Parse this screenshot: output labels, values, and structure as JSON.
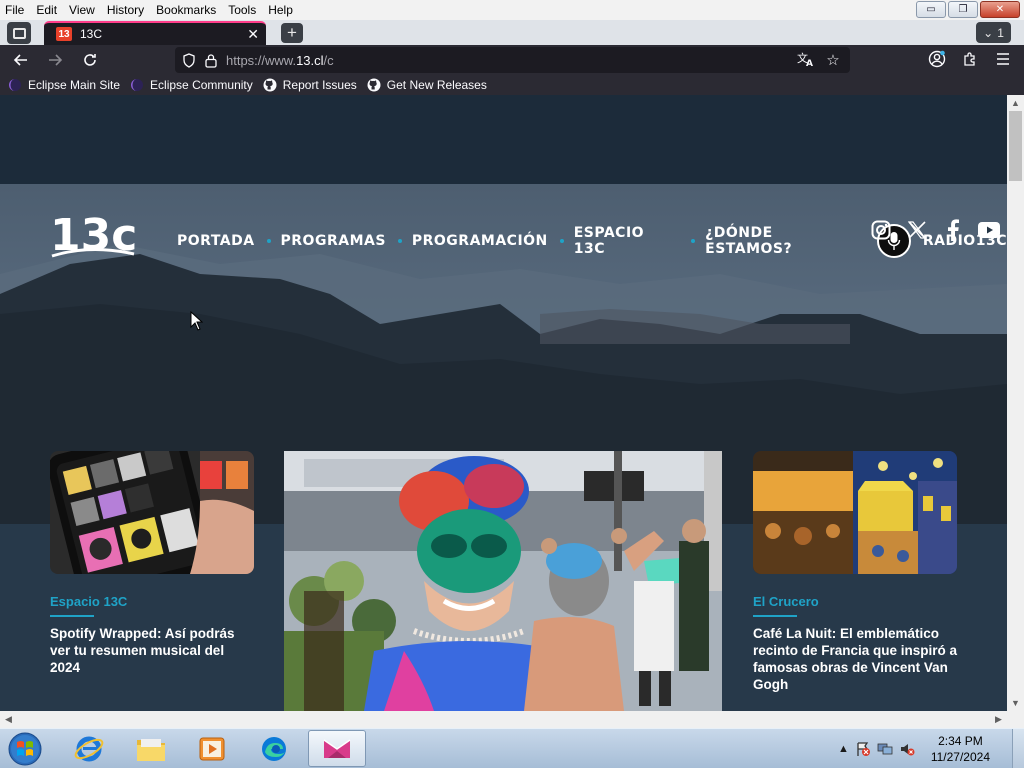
{
  "menubar": {
    "items": [
      "File",
      "Edit",
      "View",
      "History",
      "Bookmarks",
      "Tools",
      "Help"
    ]
  },
  "window": {
    "minimize": "▭",
    "restore": "❐",
    "close": "✕"
  },
  "tabstrip": {
    "active_tab": {
      "favicon": "13",
      "title": "13C",
      "close": "✕"
    },
    "new_tab": "+",
    "list_count": "1"
  },
  "navbar": {
    "url_prefix": "https://www.",
    "url_domain": "13.cl",
    "url_suffix": "/c"
  },
  "bookmarks": {
    "items": [
      {
        "label": "Eclipse Main Site",
        "icon": "eclipse-icon"
      },
      {
        "label": "Eclipse Community",
        "icon": "eclipse-icon"
      },
      {
        "label": "Report Issues",
        "icon": "github-icon"
      },
      {
        "label": "Get New Releases",
        "icon": "github-icon"
      }
    ]
  },
  "site": {
    "logo_text": "13c",
    "nav": [
      "PORTADA",
      "PROGRAMAS",
      "PROGRAMACIÓN",
      "ESPACIO 13C",
      "¿DÓNDE ESTAMOS?"
    ],
    "radio_label": "RADIO13C",
    "socials": [
      "instagram-icon",
      "x-icon",
      "facebook-icon",
      "youtube-icon"
    ],
    "accent_color": "#1fa3c7"
  },
  "cards": {
    "left": {
      "category": "Espacio 13C",
      "title": "Spotify Wrapped: Así podrás ver tu resumen musical del 2024"
    },
    "right": {
      "category": "El Crucero",
      "title": "Café La Nuit: El emblemático recinto de Francia que inspiró a famosas obras de Vincent Van Gogh"
    }
  },
  "taskbar": {
    "time": "2:34 PM",
    "date": "11/27/2024"
  }
}
